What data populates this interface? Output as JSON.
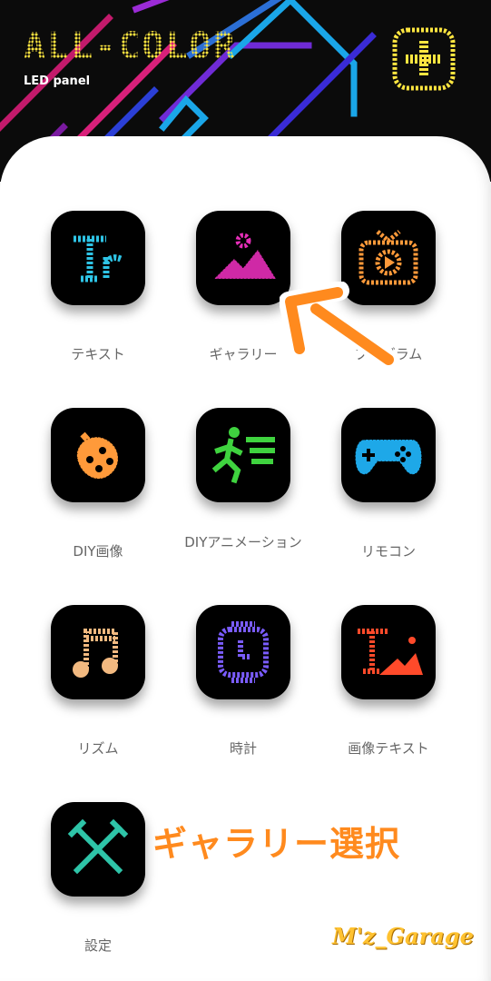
{
  "header": {
    "logo_text": "ALL-COLOR",
    "subtitle": "LED panel",
    "add_button_icon": "plus-icon"
  },
  "menu": {
    "items": [
      {
        "label": "テキスト",
        "icon": "text-icon",
        "color": "#2ec4e6"
      },
      {
        "label": "ギャラリー",
        "icon": "gallery-icon",
        "color": "#e62eb8"
      },
      {
        "label": "プログラム",
        "icon": "tv-program-icon",
        "color": "#ff9a3a"
      },
      {
        "label": "DIY画像",
        "icon": "diy-image-icon",
        "color": "#ff9a3a"
      },
      {
        "label": "DIYアニメーション",
        "icon": "running-person-icon",
        "color": "#3fd33f"
      },
      {
        "label": "リモコン",
        "icon": "gamepad-icon",
        "color": "#1ea8e8"
      },
      {
        "label": "リズム",
        "icon": "music-note-icon",
        "color": "#f2b980"
      },
      {
        "label": "時計",
        "icon": "clock-icon",
        "color": "#7a5cff"
      },
      {
        "label": "画像テキスト",
        "icon": "image-text-icon",
        "color": "#ff4a2a"
      },
      {
        "label": "設定",
        "icon": "settings-tools-icon",
        "color": "#2ec4a8"
      }
    ]
  },
  "annotation": {
    "text": "ギャラリー選択",
    "color": "#ff8a1e"
  },
  "watermark": {
    "text": "M'z_Garage"
  }
}
